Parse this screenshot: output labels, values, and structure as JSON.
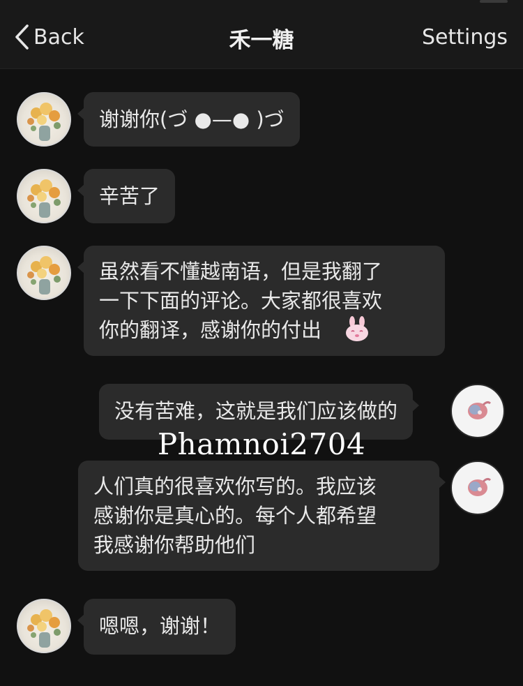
{
  "header": {
    "back_label": "Back",
    "title": "禾一糖",
    "settings_label": "Settings"
  },
  "messages": [
    {
      "side": "left",
      "text": "谢谢你(づ ●—● )づ"
    },
    {
      "side": "left",
      "text": "辛苦了"
    },
    {
      "side": "left",
      "text": "虽然看不懂越南语，但是我翻了\n一下下面的评论。大家都很喜欢\n你的翻译，感谢你的付出"
    },
    {
      "side": "right",
      "text": "没有苦难，这就是我们应该做的"
    },
    {
      "side": "right",
      "text": "人们真的很喜欢你写的。我应该\n感谢你是真心的。每个人都希望\n我感谢你帮助他们"
    },
    {
      "side": "left",
      "text": "嗯嗯，谢谢！"
    }
  ],
  "watermark": "Phamnoi2704",
  "colors": {
    "background": "#111111",
    "header": "#191919",
    "bubble": "#2b2b2b",
    "text": "#e9e9e9"
  },
  "icons": {
    "back": "chevron-left-icon",
    "emoji": "bunny-emoji-icon"
  }
}
